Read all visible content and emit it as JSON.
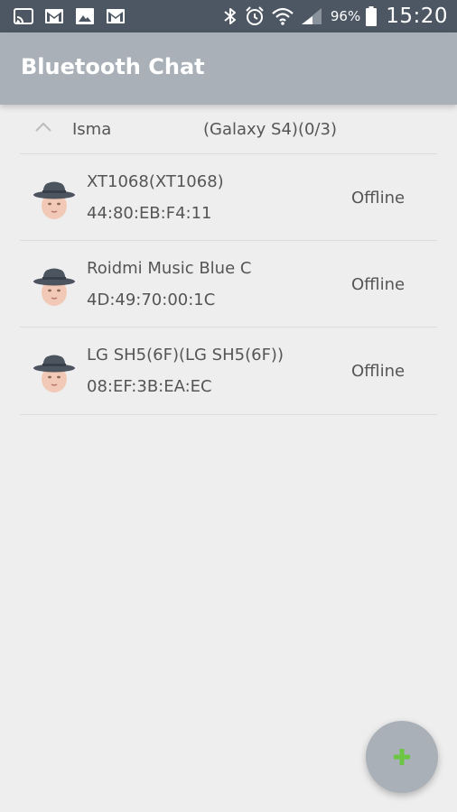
{
  "status_bar": {
    "battery_percent": "96%",
    "clock": "15:20",
    "left_icons": [
      "cast-icon",
      "gmail-icon",
      "gallery-icon",
      "gmail-icon"
    ],
    "right_icons": [
      "bluetooth-icon",
      "alarm-icon",
      "wifi-icon",
      "signal-icon",
      "battery-icon"
    ]
  },
  "app_bar": {
    "title": "Bluetooth Chat",
    "color": "#a9b0b8"
  },
  "group": {
    "name": "Isma",
    "info": "(Galaxy S4)(0/3)",
    "expanded": true
  },
  "devices": [
    {
      "name": "XT1068(XT1068)",
      "address": "44:80:EB:F4:11",
      "status": "Offline"
    },
    {
      "name": "Roidmi Music Blue C",
      "address": "4D:49:70:00:1C",
      "status": "Offline"
    },
    {
      "name": "LG SH5(6F)(LG SH5(6F))",
      "address": "08:EF:3B:EA:EC",
      "status": "Offline"
    }
  ],
  "fab": {
    "icon": "plus-icon",
    "icon_color": "#6cc644"
  }
}
